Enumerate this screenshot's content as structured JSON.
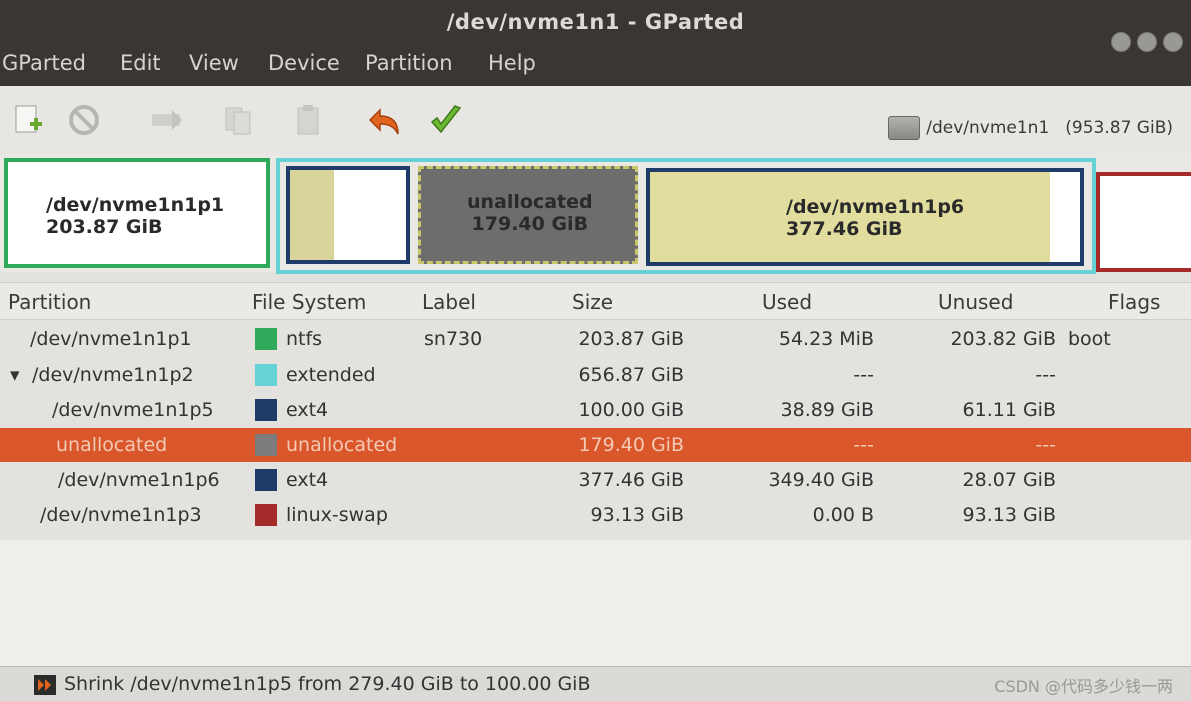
{
  "window": {
    "title": "/dev/nvme1n1 - GParted"
  },
  "menu": [
    "GParted",
    "Edit",
    "View",
    "Device",
    "Partition",
    "Help"
  ],
  "toolbar": {
    "icons": [
      "new-icon",
      "delete-icon",
      "resize-icon",
      "copy-icon",
      "paste-icon",
      "undo-icon",
      "apply-icon"
    ],
    "device": "/dev/nvme1n1",
    "device_size": "(953.87 GiB)"
  },
  "diskmap": [
    {
      "name": "/dev/nvme1n1p1",
      "size": "203.87 GiB",
      "kind": "ntfs",
      "selected": false
    },
    {
      "name": "",
      "size": "",
      "kind": "ext4-p5",
      "selected": false
    },
    {
      "name": "unallocated",
      "size": "179.40 GiB",
      "kind": "unallocated",
      "selected": true
    },
    {
      "name": "/dev/nvme1n1p6",
      "size": "377.46 GiB",
      "kind": "ext4-p6",
      "selected": false
    },
    {
      "name": "",
      "size": "",
      "kind": "linux-swap",
      "selected": false
    }
  ],
  "table": {
    "columns": [
      "Partition",
      "File System",
      "Label",
      "Size",
      "Used",
      "Unused",
      "Flags"
    ],
    "rows": [
      {
        "partition": "/dev/nvme1n1p1",
        "fs": "ntfs",
        "fs_color": "#2eaa5a",
        "label": "sn730",
        "size": "203.87 GiB",
        "used": "54.23 MiB",
        "unused": "203.82 GiB",
        "flags": "boot",
        "expander": "",
        "selected": false
      },
      {
        "partition": "/dev/nvme1n1p2",
        "fs": "extended",
        "fs_color": "#67d2d6",
        "label": "",
        "size": "656.87 GiB",
        "used": "---",
        "unused": "---",
        "flags": "",
        "expander": "▾",
        "selected": false
      },
      {
        "partition": "/dev/nvme1n1p5",
        "fs": "ext4",
        "fs_color": "#1f3b6a",
        "label": "",
        "size": "100.00 GiB",
        "used": "38.89 GiB",
        "unused": "61.11 GiB",
        "flags": "",
        "expander": "",
        "selected": false
      },
      {
        "partition": "unallocated",
        "fs": "unallocated",
        "fs_color": "#7c7c7c",
        "label": "",
        "size": "179.40 GiB",
        "used": "---",
        "unused": "---",
        "flags": "",
        "expander": "",
        "selected": true
      },
      {
        "partition": "/dev/nvme1n1p6",
        "fs": "ext4",
        "fs_color": "#1f3b6a",
        "label": "",
        "size": "377.46 GiB",
        "used": "349.40 GiB",
        "unused": "28.07 GiB",
        "flags": "",
        "expander": "",
        "selected": false
      },
      {
        "partition": "/dev/nvme1n1p3",
        "fs": "linux-swap",
        "fs_color": "#a52a2a",
        "label": "",
        "size": "93.13 GiB",
        "used": "0.00 B",
        "unused": "93.13 GiB",
        "flags": "",
        "expander": "",
        "selected": false
      }
    ]
  },
  "status": {
    "pending_operation": "Shrink /dev/nvme1n1p5 from 279.40 GiB to 100.00 GiB"
  },
  "watermark": "CSDN @代码多少钱一两"
}
